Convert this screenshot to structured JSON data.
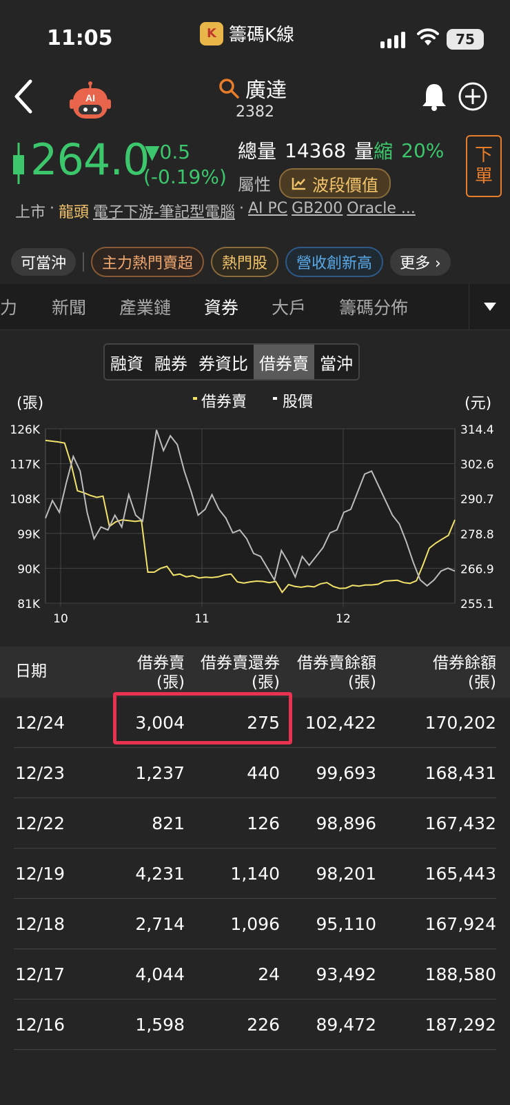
{
  "status_bar": {
    "time": "11:05",
    "app_name": "籌碼K線",
    "battery": "75"
  },
  "header": {
    "stock_name": "廣達",
    "stock_code": "2382"
  },
  "quote": {
    "price": "264.0",
    "change": "▼0.5",
    "change_pct": "(-0.19%)",
    "volume_label": "總量",
    "volume_value": "14368",
    "volume_shrink_label": "量",
    "shrink_word": "縮",
    "shrink_pct": "20%",
    "attr_label": "屬性",
    "wave_label": "波段價值",
    "order_label_1": "下",
    "order_label_2": "單"
  },
  "tags": {
    "market": "上市",
    "dot1": "·",
    "leader": "龍頭",
    "industry": "電子下游-筆記型電腦",
    "dot2": "·",
    "t1": "AI PC",
    "t2": "GB200",
    "t3": "Oracle ..."
  },
  "chips": [
    "可當沖",
    "主力熱門賣超",
    "熱門股",
    "營收創新高",
    "更多 ›"
  ],
  "tabs": [
    "力",
    "新聞",
    "產業鏈",
    "資券",
    "大戶",
    "籌碼分佈"
  ],
  "segment": [
    "融資",
    "融券",
    "券資比",
    "借券賣",
    "當沖"
  ],
  "chart_labels": {
    "left_unit": "(張)",
    "right_unit": "(元)",
    "legend1": "借券賣",
    "legend2": "股價"
  },
  "chart_data": {
    "type": "line",
    "y_left_ticks": [
      "126K",
      "117K",
      "108K",
      "99K",
      "90K",
      "81K"
    ],
    "y_right_ticks": [
      "314.4",
      "302.6",
      "290.7",
      "278.8",
      "266.9",
      "255.1"
    ],
    "x_ticks": [
      "10",
      "11",
      "12"
    ],
    "ylim_left": [
      81000,
      126000
    ],
    "ylim_right": [
      255.1,
      314.4
    ],
    "series": [
      {
        "name": "借券賣",
        "axis": "left",
        "color": "#f3e36b",
        "values": [
          123000,
          122800,
          122600,
          122300,
          117000,
          110000,
          109500,
          108800,
          108300,
          108600,
          100800,
          102000,
          102500,
          102300,
          102100,
          102300,
          89000,
          89000,
          90000,
          90500,
          88200,
          88500,
          87800,
          88100,
          87500,
          87700,
          87600,
          87800,
          88300,
          88500,
          86500,
          86200,
          86500,
          86700,
          86600,
          86300,
          86600,
          83800,
          85800,
          85300,
          85100,
          85400,
          85200,
          86000,
          86300,
          85300,
          84800,
          84900,
          85600,
          85400,
          85700,
          85700,
          85900,
          86700,
          86800,
          86900,
          86300,
          86100,
          86800,
          90800,
          95200,
          96500,
          97500,
          98500,
          102500
        ]
      },
      {
        "name": "股價",
        "axis": "right",
        "color": "#bdbdbd",
        "values": [
          284,
          290,
          286,
          296,
          305,
          300,
          286,
          277,
          281,
          280,
          285,
          281,
          292,
          285,
          283,
          298,
          314,
          307,
          312,
          309,
          300,
          293,
          285,
          287,
          292,
          287,
          284,
          279,
          280,
          277,
          272,
          271,
          267,
          263,
          273,
          269,
          264,
          271,
          268,
          271,
          274,
          279,
          280,
          286,
          287,
          293,
          299,
          300,
          295,
          290,
          285,
          282,
          276,
          269,
          263,
          261,
          263,
          266,
          267,
          266
        ]
      }
    ]
  },
  "table": {
    "headers": [
      {
        "line1": "日期",
        "line2": ""
      },
      {
        "line1": "借券賣",
        "line2": "(張)"
      },
      {
        "line1": "借券賣還券",
        "line2": "(張)"
      },
      {
        "line1": "借券賣餘額",
        "line2": "(張)"
      },
      {
        "line1": "借券餘額",
        "line2": "(張)"
      }
    ],
    "rows": [
      [
        "12/24",
        "3,004",
        "275",
        "102,422",
        "170,202"
      ],
      [
        "12/23",
        "1,237",
        "440",
        "99,693",
        "168,431"
      ],
      [
        "12/22",
        "821",
        "126",
        "98,896",
        "167,432"
      ],
      [
        "12/19",
        "4,231",
        "1,140",
        "98,201",
        "165,443"
      ],
      [
        "12/18",
        "2,714",
        "1,096",
        "95,110",
        "167,924"
      ],
      [
        "12/17",
        "4,044",
        "24",
        "93,492",
        "188,580"
      ],
      [
        "12/16",
        "1,598",
        "226",
        "89,472",
        "187,292"
      ]
    ]
  },
  "colors": {
    "up_down_green": "#3cc76d",
    "highlight_red": "#e8324f",
    "accent_gold": "#f3c46c",
    "order_orange": "#e87d2a"
  }
}
